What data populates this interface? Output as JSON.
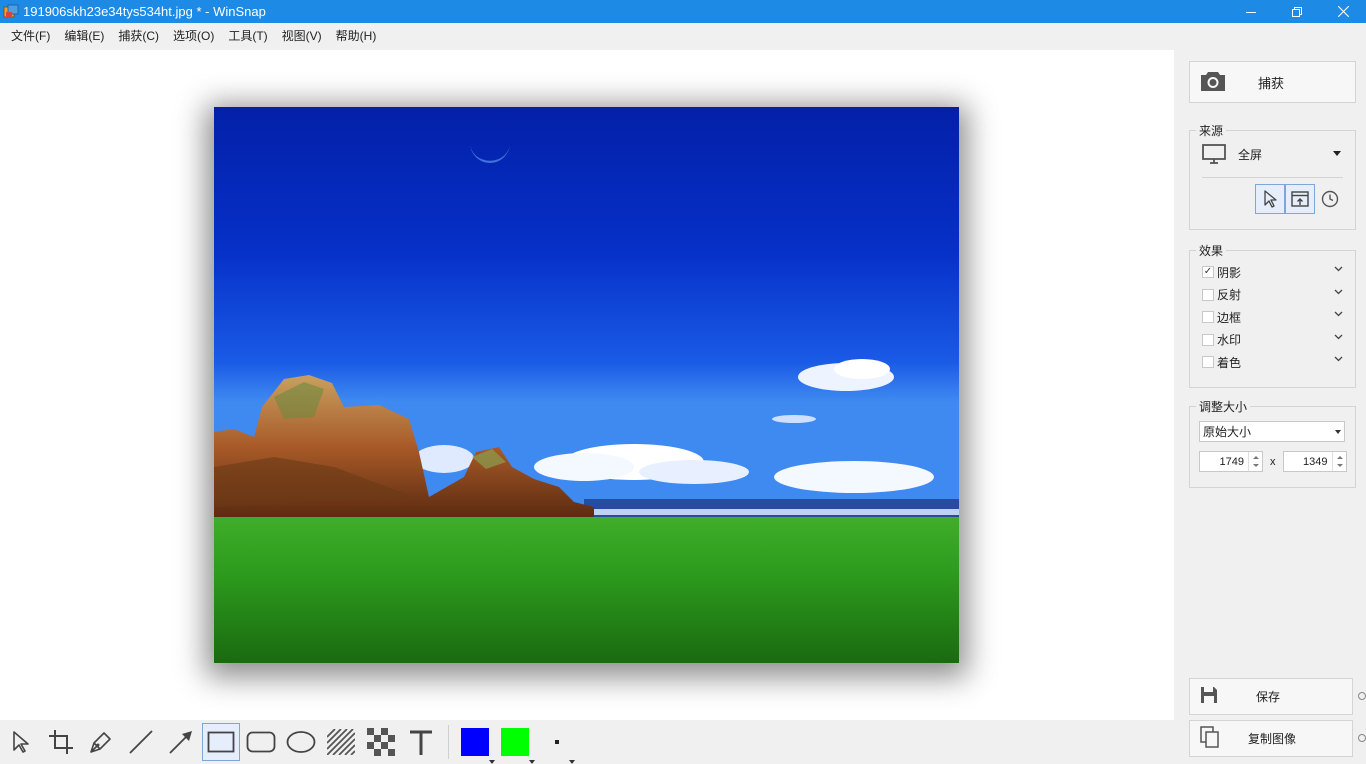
{
  "window": {
    "title": "191906skh23e34tys534ht.jpg * - WinSnap",
    "app_icon": "winsnap-icon",
    "controls": [
      "minimize-icon",
      "restore-icon",
      "close-icon"
    ]
  },
  "menubar": {
    "items": [
      {
        "label": "文件(F)"
      },
      {
        "label": "编辑(E)"
      },
      {
        "label": "捕获(C)"
      },
      {
        "label": "选项(O)"
      },
      {
        "label": "工具(T)"
      },
      {
        "label": "视图(V)"
      },
      {
        "label": "帮助(H)"
      }
    ]
  },
  "canvas": {
    "image_description_icon": "landscape-photo",
    "shadow_effect": true
  },
  "toolbar": {
    "tools": [
      {
        "icon": "pointer-icon"
      },
      {
        "icon": "crop-icon"
      },
      {
        "icon": "pen-icon"
      },
      {
        "icon": "line-icon"
      },
      {
        "icon": "arrow-icon"
      },
      {
        "icon": "rectangle-icon",
        "active": true
      },
      {
        "icon": "rounded-rectangle-icon"
      },
      {
        "icon": "ellipse-icon"
      },
      {
        "icon": "hatch-icon"
      },
      {
        "icon": "pixelate-icon"
      },
      {
        "icon": "text-icon"
      }
    ],
    "colors": {
      "primary": "#0000ff",
      "secondary": "#00ff00"
    }
  },
  "panel": {
    "capture": {
      "label": "捕获",
      "icon": "camera-icon"
    },
    "source": {
      "title": "来源",
      "selected": "全屏",
      "icon": "monitor-icon",
      "modes": [
        {
          "icon": "cursor-icon",
          "active": true
        },
        {
          "icon": "window-capture-icon",
          "active": true
        },
        {
          "icon": "clock-icon",
          "active": false
        }
      ]
    },
    "effects": {
      "title": "效果",
      "items": [
        {
          "label": "阴影",
          "checked": true
        },
        {
          "label": "反射",
          "checked": false
        },
        {
          "label": "边框",
          "checked": false
        },
        {
          "label": "水印",
          "checked": false
        },
        {
          "label": "着色",
          "checked": false
        }
      ]
    },
    "resize": {
      "title": "调整大小",
      "selected": "原始大小",
      "width": "1749",
      "height": "1349",
      "times": "x"
    },
    "save": {
      "label": "保存",
      "icon": "floppy-disk-icon"
    },
    "copy": {
      "label": "复制图像",
      "icon": "copy-icon"
    }
  }
}
